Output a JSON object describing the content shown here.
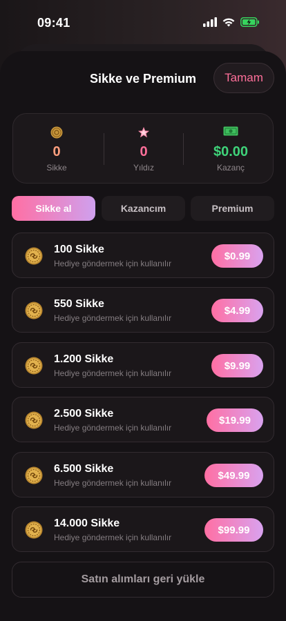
{
  "status_bar": {
    "time": "09:41"
  },
  "sheet": {
    "title": "Sikke ve Premium",
    "done_label": "Tamam"
  },
  "stats": [
    {
      "value": "0",
      "label": "Sikke",
      "icon": "coin-icon",
      "color": "#ff9f7e"
    },
    {
      "value": "0",
      "label": "Yıldız",
      "icon": "star-icon",
      "color": "#ff6f9a"
    },
    {
      "value": "$0.00",
      "label": "Kazanç",
      "icon": "cash-icon",
      "color": "#3fd37a"
    }
  ],
  "tabs": [
    {
      "label": "Sikke al",
      "active": true
    },
    {
      "label": "Kazancım",
      "active": false
    },
    {
      "label": "Premium",
      "active": false
    }
  ],
  "packages": [
    {
      "title": "100 Sikke",
      "subtitle": "Hediye göndermek için kullanılır",
      "price": "$0.99"
    },
    {
      "title": "550 Sikke",
      "subtitle": "Hediye göndermek için kullanılır",
      "price": "$4.99"
    },
    {
      "title": "1.200 Sikke",
      "subtitle": "Hediye göndermek için kullanılır",
      "price": "$9.99"
    },
    {
      "title": "2.500 Sikke",
      "subtitle": "Hediye göndermek için kullanılır",
      "price": "$19.99"
    },
    {
      "title": "6.500 Sikke",
      "subtitle": "Hediye göndermek için kullanılır",
      "price": "$49.99"
    },
    {
      "title": "14.000 Sikke",
      "subtitle": "Hediye göndermek için kullanılır",
      "price": "$99.99"
    }
  ],
  "restore_label": "Satın alımları geri yükle",
  "colors": {
    "accent_start": "#ff6fa3",
    "accent_end": "#cfa0ee",
    "done_text": "#ff6f9a",
    "earnings_green": "#3fd37a"
  }
}
